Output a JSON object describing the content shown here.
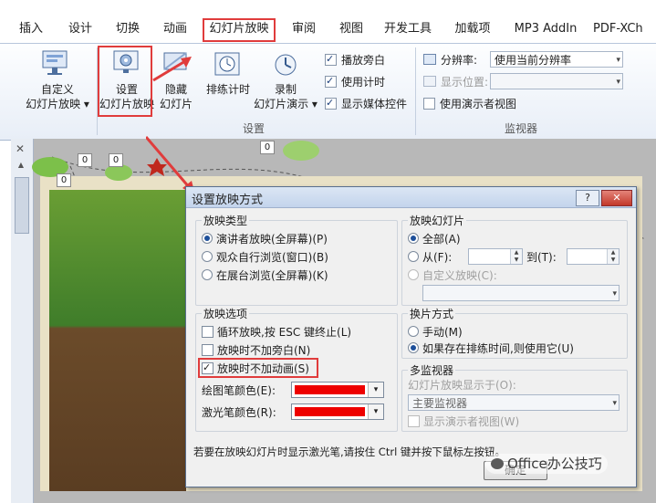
{
  "ribbon": {
    "tabs": [
      "插入",
      "设计",
      "切换",
      "动画",
      "幻灯片放映",
      "审阅",
      "视图",
      "开发工具",
      "加载项",
      "MP3 AddIn",
      "PDF-XCh"
    ],
    "active_tab": "幻灯片放映",
    "custom_show": {
      "line1": "自定义",
      "line2": "幻灯片放映 ▾"
    },
    "setup_show": {
      "line1": "设置",
      "line2": "幻灯片放映"
    },
    "hide_slide": {
      "line1": "隐藏",
      "line2": "幻灯片"
    },
    "rehearse_timings": "排练计时",
    "record": {
      "line1": "录制",
      "line2": "幻灯片演示 ▾"
    },
    "play_narration": "播放旁白",
    "use_timings": "使用计时",
    "show_media_controls": "显示媒体控件",
    "setup_group": "设置",
    "resolution_label": "分辨率:",
    "resolution_value": "使用当前分辨率",
    "display_on_label": "显示位置:",
    "use_presenter_view": "使用演示者视图",
    "monitors_group": "监视器"
  },
  "slide": {
    "badges": [
      "0",
      "0",
      "0",
      "0"
    ]
  },
  "dialog": {
    "title": "设置放映方式",
    "help": "?",
    "close": "✕",
    "show_type": {
      "legend": "放映类型",
      "options": [
        "演讲者放映(全屏幕)(P)",
        "观众自行浏览(窗口)(B)",
        "在展台浏览(全屏幕)(K)"
      ],
      "selected": 0
    },
    "show_slides": {
      "legend": "放映幻灯片",
      "all": "全部(A)",
      "from": "从(F):",
      "to": "到(T):",
      "custom": "自定义放映(C):"
    },
    "show_options": {
      "legend": "放映选项",
      "loop": "循环放映,按 ESC 键终止(L)",
      "no_narration": "放映时不加旁白(N)",
      "no_animation": "放映时不加动画(S)",
      "pen_color": "绘图笔颜色(E):",
      "laser_color": "激光笔颜色(R):",
      "pen_color_hex": "#ee0000",
      "laser_color_hex": "#ee0000"
    },
    "advance": {
      "legend": "换片方式",
      "manual": "手动(M)",
      "timings": "如果存在排练时间,则使用它(U)"
    },
    "multi_monitor": {
      "legend": "多监视器",
      "display_on": "幻灯片放映显示于(O):",
      "value": "主要监视器",
      "presenter": "显示演示者视图(W)"
    },
    "footer_note": "若要在放映幻灯片时显示激光笔,请按住 Ctrl 键并按下鼠标左按钮。",
    "ok": "确定"
  },
  "watermark": "Office办公技巧",
  "colors": {
    "highlight": "#e03c3c",
    "accent": "#1d4f9a"
  }
}
